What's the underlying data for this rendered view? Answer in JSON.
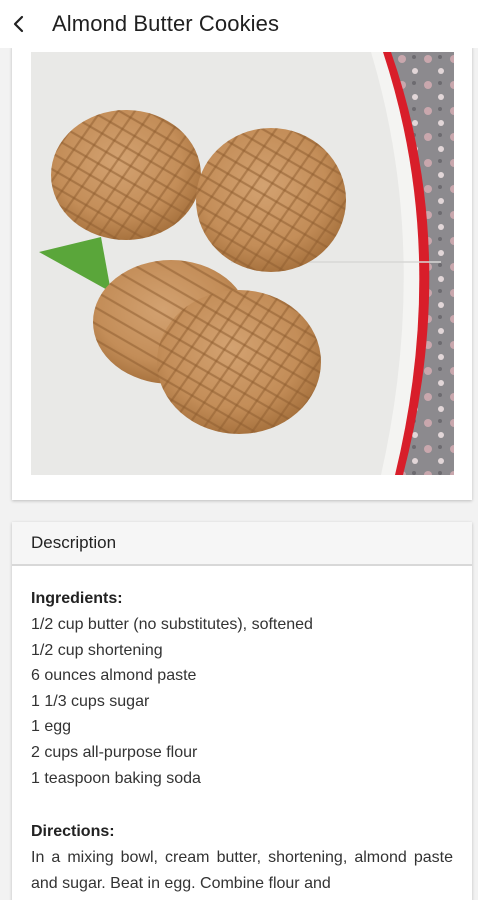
{
  "header": {
    "title": "Almond Butter Cookies",
    "back_icon": "chevron-left-icon"
  },
  "description": {
    "section_title": "Description",
    "ingredients_label": "Ingredients:",
    "ingredients": [
      "1/2 cup butter (no substitutes), softened",
      "1/2 cup shortening",
      "6 ounces almond paste",
      "1 1/3 cups sugar",
      "1 egg",
      "2 cups all-purpose flour",
      "1 teaspoon baking soda"
    ],
    "directions_label": "Directions:",
    "directions": "In a mixing bowl, cream butter, shortening, almond paste and sugar. Beat in egg. Combine flour and"
  },
  "colors": {
    "header_bg": "#ffffff",
    "page_bg": "#f2f2f2",
    "card_bg": "#ffffff",
    "card_header_bg": "#f6f6f6",
    "plate_rim": "#d81e2a",
    "cookie": "#c89562"
  }
}
